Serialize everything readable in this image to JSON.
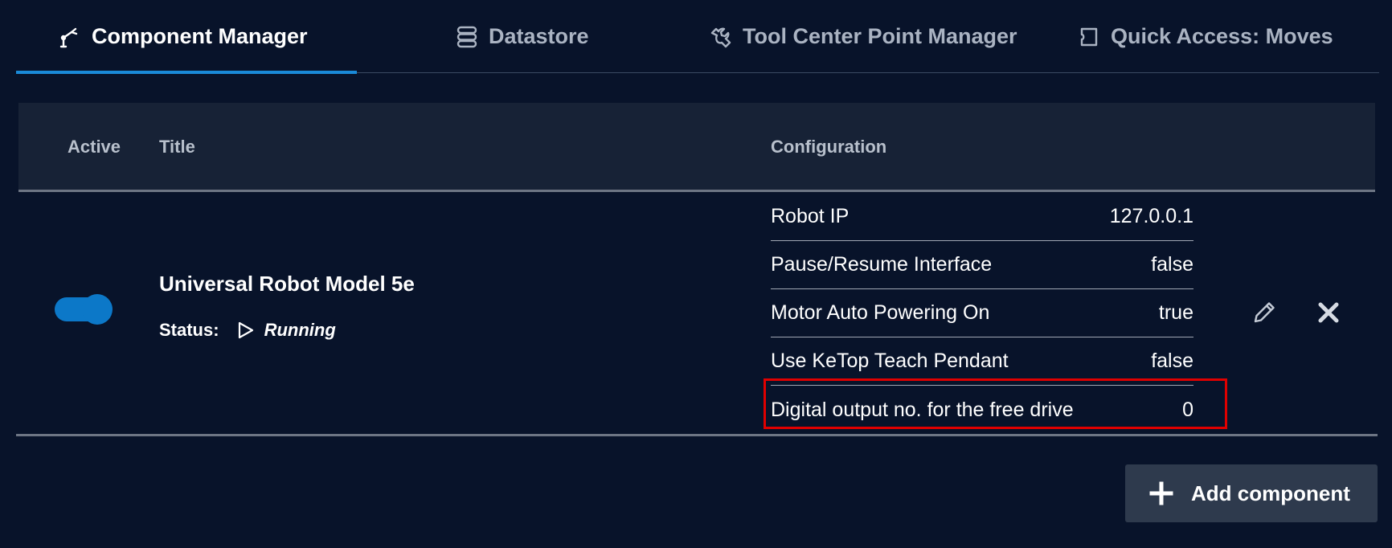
{
  "tabs": [
    {
      "label": "Component Manager",
      "icon": "robot-arm-icon",
      "active": true
    },
    {
      "label": "Datastore",
      "icon": "database-icon",
      "active": false
    },
    {
      "label": "Tool Center Point Manager",
      "icon": "wrench-icon",
      "active": false
    },
    {
      "label": "Quick Access: Moves",
      "icon": "puzzle-icon",
      "active": false
    }
  ],
  "table": {
    "headers": {
      "active": "Active",
      "title": "Title",
      "configuration": "Configuration"
    },
    "rows": [
      {
        "active": true,
        "title": "Universal Robot Model 5e",
        "status_label": "Status:",
        "status_value": "Running",
        "config": [
          {
            "key": "Robot IP",
            "value": "127.0.0.1"
          },
          {
            "key": "Pause/Resume Interface",
            "value": "false"
          },
          {
            "key": "Motor Auto Powering On",
            "value": "true"
          },
          {
            "key": "Use KeTop Teach Pendant",
            "value": "false"
          },
          {
            "key": "Digital output no. for the free drive",
            "value": "0"
          }
        ]
      }
    ]
  },
  "add_button": {
    "label": "Add component",
    "icon": "plus-icon"
  },
  "colors": {
    "accent": "#1a8ad8",
    "toggle": "#0c78c8",
    "highlight": "#e00000",
    "background": "#08132a"
  }
}
